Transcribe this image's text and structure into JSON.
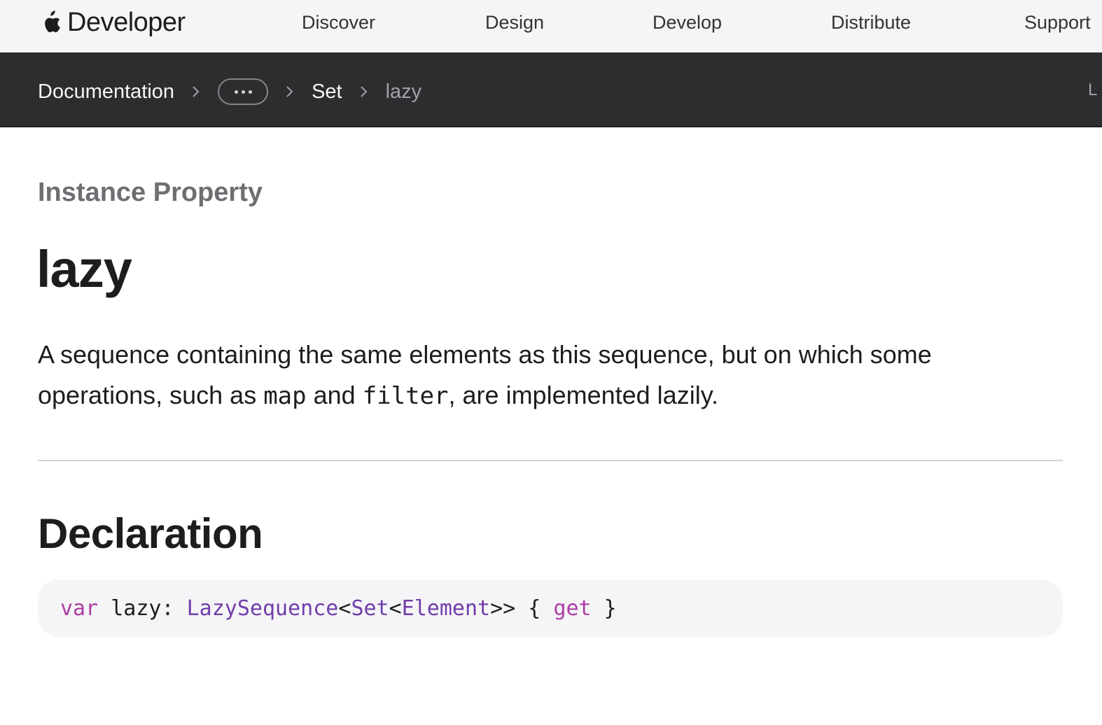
{
  "globalnav": {
    "brand": "Developer",
    "links": [
      "Discover",
      "Design",
      "Develop",
      "Distribute",
      "Support"
    ]
  },
  "subnav": {
    "breadcrumbs": {
      "root": "Documentation",
      "parent": "Set",
      "current": "lazy"
    },
    "language_edge": "L"
  },
  "page": {
    "eyebrow": "Instance Property",
    "title": "lazy",
    "abstract": {
      "part1": "A sequence containing the same elements as this sequence, but on which some operations, such as ",
      "code1": "map",
      "part2": " and ",
      "code2": "filter",
      "part3": ", are implemented lazily."
    },
    "declaration_heading": "Declaration",
    "declaration": {
      "kw_var": "var",
      "name": " lazy: ",
      "type1": "LazySequence",
      "lt1": "<",
      "type2": "Set",
      "lt2": "<",
      "type3": "Element",
      "gt": ">> { ",
      "kw_get": "get",
      "close": " }"
    }
  },
  "colors": {
    "nav_bg": "#f5f5f7",
    "subnav_bg": "#2d2d2f",
    "keyword": "#ad3da4",
    "type": "#703daa"
  }
}
